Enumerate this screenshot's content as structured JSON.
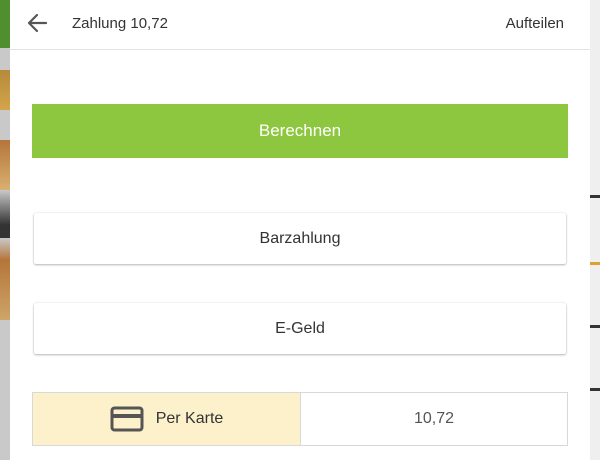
{
  "header": {
    "back_icon": "arrow-left-icon",
    "title": "Zahlung 10,72",
    "split_label": "Aufteilen"
  },
  "calculate": {
    "label": "Berechnen",
    "color": "#8dc63f"
  },
  "payment_methods": [
    {
      "label": "Barzahlung"
    },
    {
      "label": "E-Geld"
    }
  ],
  "card_payment": {
    "icon": "credit-card-icon",
    "label": "Per Karte",
    "amount": "10,72",
    "highlight_color": "#fdf1cc"
  }
}
